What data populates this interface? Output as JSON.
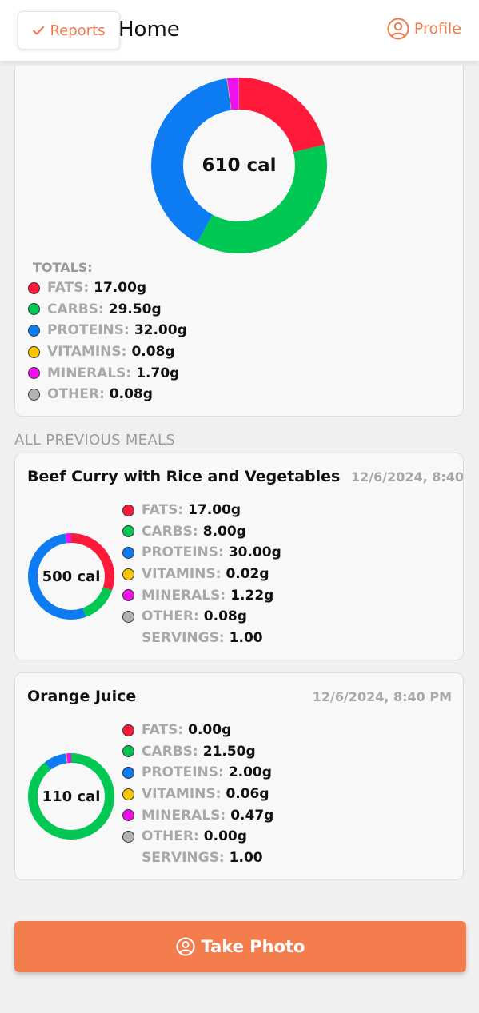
{
  "header": {
    "reports_label": "Reports",
    "title": "Home",
    "profile_label": "Profile"
  },
  "summary": {
    "total_calories": "610 cal",
    "totals_label": "TOTALS:",
    "nutrients": [
      {
        "label": "FATS:",
        "value": "17.00g",
        "color": "#ff1a3a"
      },
      {
        "label": "CARBS:",
        "value": "29.50g",
        "color": "#00c853"
      },
      {
        "label": "PROTEINS:",
        "value": "32.00g",
        "color": "#0d7cf2"
      },
      {
        "label": "VITAMINS:",
        "value": "0.08g",
        "color": "#ffc400"
      },
      {
        "label": "MINERALS:",
        "value": "1.70g",
        "color": "#ee11ee"
      },
      {
        "label": "OTHER:",
        "value": "0.08g",
        "color": "#b3b3b3"
      }
    ],
    "donut": [
      17.0,
      29.5,
      32.0,
      0.08,
      1.7,
      0.08
    ]
  },
  "section_title": "ALL PREVIOUS MEALS",
  "meals": [
    {
      "name": "Beef Curry with Rice and Vegetables",
      "time": "12/6/2024, 8:40",
      "calories": "500 cal",
      "nutrients": [
        {
          "label": "FATS:",
          "value": "17.00g"
        },
        {
          "label": "CARBS:",
          "value": "8.00g"
        },
        {
          "label": "PROTEINS:",
          "value": "30.00g"
        },
        {
          "label": "VITAMINS:",
          "value": "0.02g"
        },
        {
          "label": "MINERALS:",
          "value": "1.22g"
        },
        {
          "label": "OTHER:",
          "value": "0.08g"
        }
      ],
      "servings_label": "SERVINGS:",
      "servings": "1.00",
      "donut": [
        17.0,
        8.0,
        30.0,
        0.02,
        1.22,
        0.08
      ]
    },
    {
      "name": "Orange Juice",
      "time": "12/6/2024, 8:40 PM",
      "calories": "110 cal",
      "nutrients": [
        {
          "label": "FATS:",
          "value": "0.00g"
        },
        {
          "label": "CARBS:",
          "value": "21.50g"
        },
        {
          "label": "PROTEINS:",
          "value": "2.00g"
        },
        {
          "label": "VITAMINS:",
          "value": "0.06g"
        },
        {
          "label": "MINERALS:",
          "value": "0.47g"
        },
        {
          "label": "OTHER:",
          "value": "0.00g"
        }
      ],
      "servings_label": "SERVINGS:",
      "servings": "1.00",
      "donut": [
        0.0,
        21.5,
        2.0,
        0.06,
        0.47,
        0.0
      ]
    }
  ],
  "take_photo_label": "Take Photo",
  "colors": {
    "accent": "#f47d4e",
    "fats": "#ff1a3a",
    "carbs": "#00c853",
    "proteins": "#0d7cf2",
    "vitamins": "#ffc400",
    "minerals": "#ee11ee",
    "other": "#b3b3b3"
  }
}
